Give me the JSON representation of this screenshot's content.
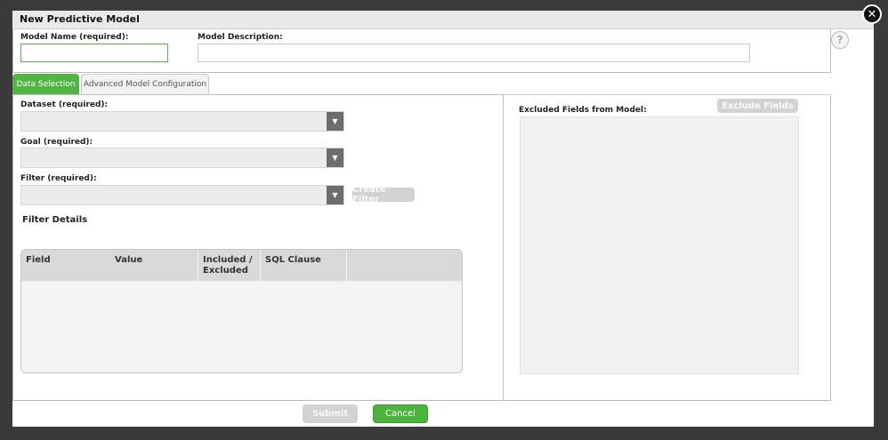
{
  "dialog": {
    "title": "New Predictive Model",
    "close_icon": "close-icon",
    "help_icon": "help-icon",
    "help_glyph": "?"
  },
  "model_name": {
    "label": "Model Name (required):",
    "value": "",
    "placeholder": ""
  },
  "model_description": {
    "label": "Model Description:",
    "value": "",
    "placeholder": ""
  },
  "tabs": [
    {
      "label": "Data Selection",
      "active": true
    },
    {
      "label": "Advanced Model Configuration",
      "active": false
    }
  ],
  "data_selection": {
    "dataset": {
      "label": "Dataset (required):",
      "value": ""
    },
    "goal": {
      "label": "Goal (required):",
      "value": ""
    },
    "filter": {
      "label": "Filter (required):",
      "value": ""
    },
    "create_filter_label": "Create Filter",
    "filter_details_title": "Filter Details",
    "filter_table": {
      "columns": [
        "Field",
        "Value",
        "Included / Excluded",
        "SQL Clause",
        ""
      ],
      "rows": []
    }
  },
  "excluded_fields": {
    "label": "Excluded Fields from Model:",
    "button_label": "Exclude Fields",
    "items": []
  },
  "footer": {
    "submit_label": "Submit",
    "cancel_label": "Cancel"
  },
  "colors": {
    "accent_green": "#4cb43e",
    "disabled_gray": "#d3d3d3",
    "overlay": "#3a3a3a"
  }
}
